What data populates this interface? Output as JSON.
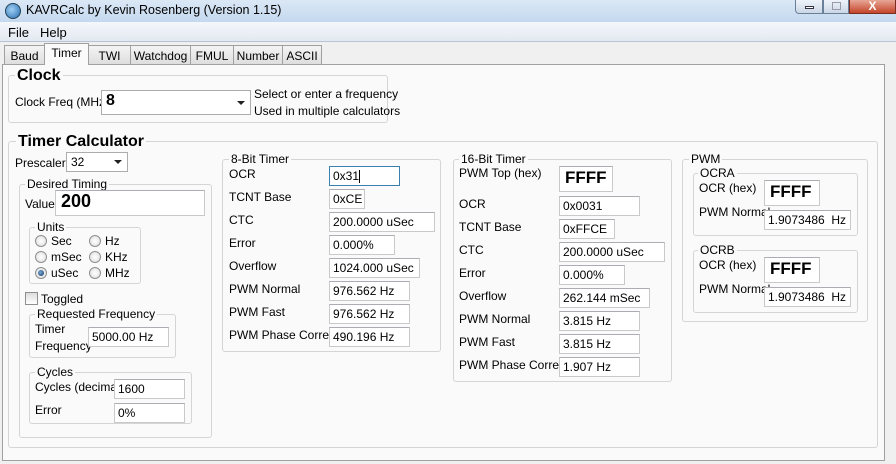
{
  "window": {
    "title": "KAVRCalc by Kevin Rosenberg (Version 1.15)",
    "close_label": "X"
  },
  "menu": [
    "File",
    "Help"
  ],
  "tabs": [
    {
      "label": "Baud"
    },
    {
      "label": "Timer",
      "selected": true
    },
    {
      "label": "TWI"
    },
    {
      "label": "Watchdog"
    },
    {
      "label": "FMUL"
    },
    {
      "label": "Number"
    },
    {
      "label": "ASCII"
    }
  ],
  "clock": {
    "title": "Clock",
    "freq_label": "Clock Freq (MHz)",
    "freq_value": "8",
    "hint1": "Select or enter a frequency",
    "hint2": "Used in multiple calculators"
  },
  "timer": {
    "title": "Timer Calculator",
    "prescaler_label": "Prescaler:",
    "prescaler_value": "32",
    "desired": {
      "title": "Desired Timing",
      "value_label": "Value",
      "value": "200",
      "units_title": "Units",
      "units": [
        "Sec",
        "mSec",
        "uSec",
        "Hz",
        "KHz",
        "MHz"
      ],
      "selected_unit": "uSec",
      "toggled_label": "Toggled",
      "toggled": false,
      "reqfreq_title": "Requested Frequency",
      "reqfreq_label1": "Timer",
      "reqfreq_label2": "Frequency",
      "reqfreq_value": "5000.00 Hz",
      "cycles_title": "Cycles",
      "cycles_label": "Cycles (decimal)",
      "cycles_value": "1600",
      "error_label": "Error",
      "error_value": "0%"
    },
    "bit8": {
      "title": "8-Bit Timer",
      "rows": [
        {
          "label": "OCR",
          "value": "0x31"
        },
        {
          "label": "TCNT Base",
          "value": "0xCE"
        },
        {
          "label": "CTC",
          "value": "200.0000 uSec"
        },
        {
          "label": "Error",
          "value": "0.000%"
        },
        {
          "label": "Overflow",
          "value": "1024.000 uSec"
        },
        {
          "label": "PWM Normal",
          "value": "976.562 Hz"
        },
        {
          "label": "PWM Fast",
          "value": "976.562 Hz"
        },
        {
          "label": "PWM Phase Correct",
          "value": "490.196 Hz"
        }
      ]
    },
    "bit16": {
      "title": "16-Bit Timer",
      "top_label": "PWM Top (hex)",
      "top_value": "FFFF",
      "rows": [
        {
          "label": "OCR",
          "value": "0x0031"
        },
        {
          "label": "TCNT Base",
          "value": "0xFFCE"
        },
        {
          "label": "CTC",
          "value": "200.0000 uSec"
        },
        {
          "label": "Error",
          "value": "0.000%"
        },
        {
          "label": "Overflow",
          "value": "262.144 mSec"
        },
        {
          "label": "PWM Normal",
          "value": "3.815 Hz"
        },
        {
          "label": "PWM Fast",
          "value": "3.815 Hz"
        },
        {
          "label": "PWM Phase Correct",
          "value": "1.907 Hz"
        }
      ]
    },
    "pwm": {
      "title": "PWM",
      "ocra": {
        "title": "OCRA",
        "ocr_label": "OCR (hex)",
        "ocr_value": "FFFF",
        "normal_label": "PWM Normal",
        "normal_value": "1.9073486",
        "normal_unit": "Hz"
      },
      "ocrb": {
        "title": "OCRB",
        "ocr_label": "OCR (hex)",
        "ocr_value": "FFFF",
        "normal_label": "PWM Normal",
        "normal_value": "1.9073486",
        "normal_unit": "Hz"
      }
    }
  }
}
